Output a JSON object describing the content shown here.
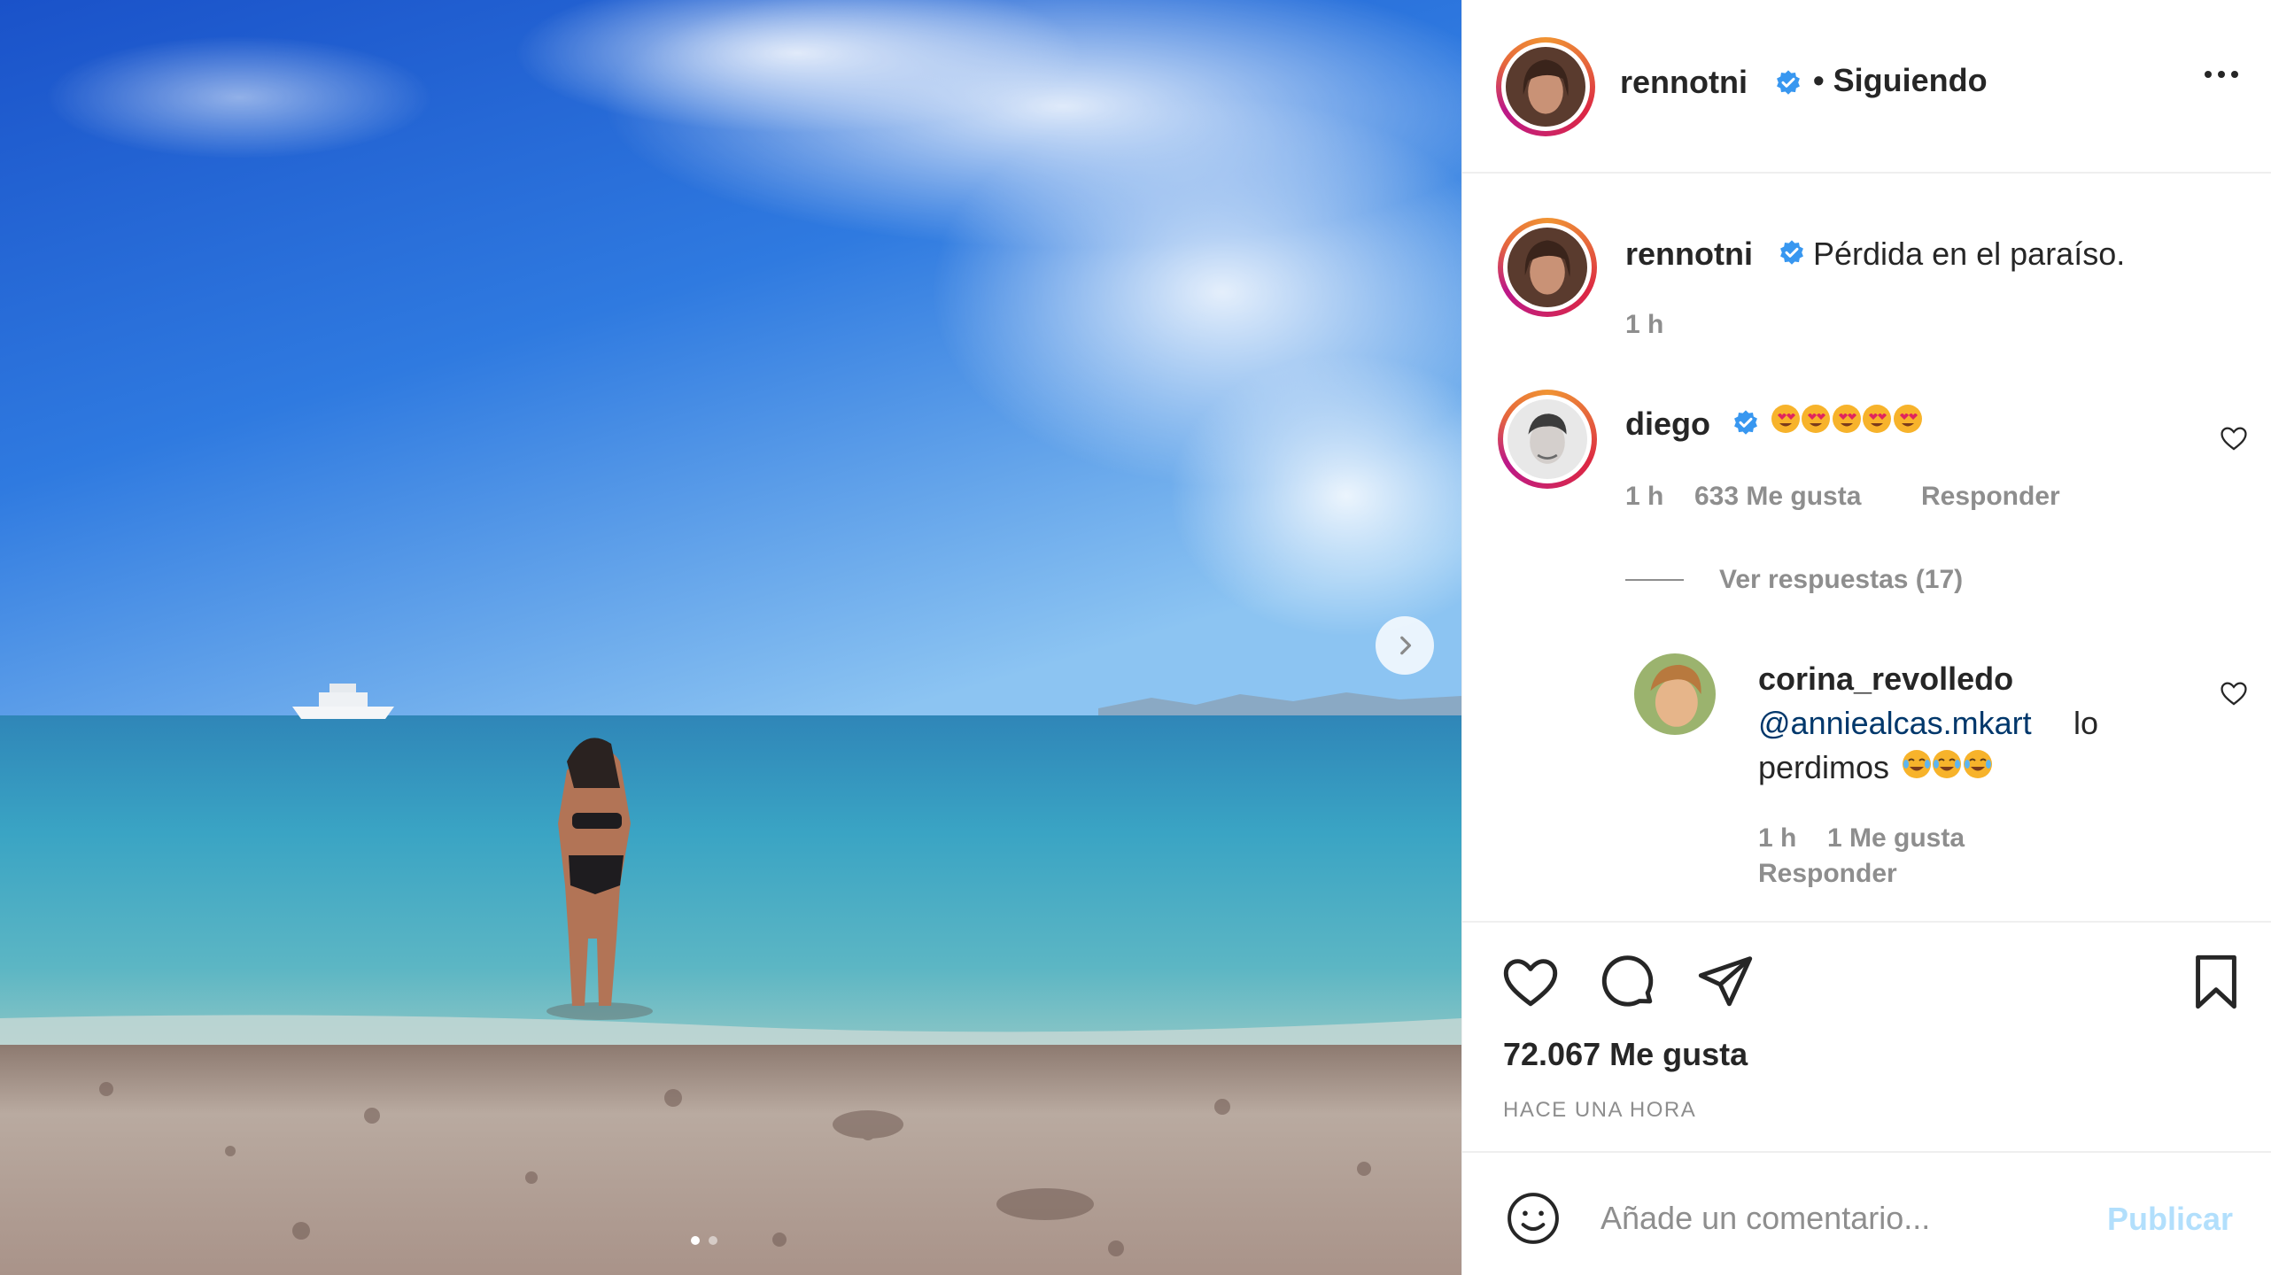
{
  "post_author": {
    "username": "rennotni",
    "verified": true,
    "follow_status": "• Siguiendo"
  },
  "caption": {
    "username": "rennotni",
    "text": "Pérdida en el paraíso.",
    "time": "1 h"
  },
  "comments": [
    {
      "username": "diego",
      "verified": true,
      "emojis": [
        "heart-eyes-emoji",
        "heart-eyes-emoji",
        "heart-eyes-emoji",
        "heart-eyes-emoji",
        "heart-eyes-emoji"
      ],
      "time": "1 h",
      "likes": "633 Me gusta",
      "reply_label": "Responder",
      "view_replies": "Ver respuestas (17)",
      "replies": [
        {
          "username": "corina_revolledo",
          "mention": "@anniealcas.mkart",
          "text_after_mention": "lo",
          "text_line2": "perdimos",
          "emojis": [
            "crying-laughing-emoji",
            "crying-laughing-emoji",
            "crying-laughing-emoji"
          ],
          "time": "1 h",
          "likes": "1 Me gusta",
          "reply_label": "Responder"
        }
      ]
    }
  ],
  "post_stats": {
    "likes": "72.067 Me gusta",
    "posted": "HACE UNA HORA"
  },
  "comment_box": {
    "placeholder": "Añade un comentario...",
    "publish_label": "Publicar"
  },
  "carousel": {
    "total_slides": 2,
    "current_slide": 1
  },
  "icons": {
    "like": "heart-icon",
    "comment": "comment-icon",
    "share": "send-icon",
    "save": "bookmark-icon",
    "emoji_picker": "smiley-icon",
    "options": "more-options-icon",
    "next": "chevron-right-icon",
    "verified": "verified-badge-icon"
  },
  "colors": {
    "verified_blue": "#3897f0",
    "mention_blue": "#00376b",
    "publish_disabled": "#b2dffc",
    "secondary_text": "#8e8e8e"
  }
}
